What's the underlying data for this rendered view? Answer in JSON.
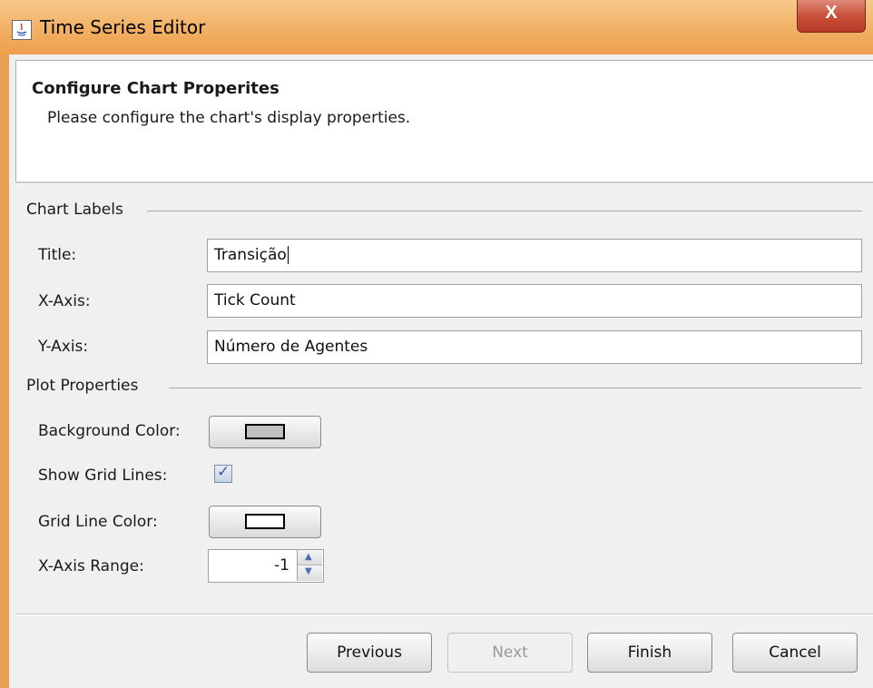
{
  "window": {
    "title": "Time Series Editor",
    "close_label": "X"
  },
  "header": {
    "title": "Configure Chart Properites",
    "description": "Please configure the chart's display properties."
  },
  "chart_labels": {
    "section_label": "Chart Labels",
    "title_label": "Title:",
    "title_value": "Transição",
    "xaxis_label": "X-Axis:",
    "xaxis_value": "Tick Count",
    "yaxis_label": "Y-Axis:",
    "yaxis_value": "Número de Agentes"
  },
  "plot_properties": {
    "section_label": "Plot Properties",
    "background_color_label": "Background Color:",
    "background_color": "#c0c0c0",
    "show_grid_lines_label": "Show Grid Lines:",
    "show_grid_lines": true,
    "grid_line_color_label": "Grid Line Color:",
    "grid_line_color": "#ffffff",
    "xaxis_range_label": "X-Axis Range:",
    "xaxis_range_value": "-1"
  },
  "buttons": {
    "previous": "Previous",
    "next": "Next",
    "finish": "Finish",
    "cancel": "Cancel"
  }
}
